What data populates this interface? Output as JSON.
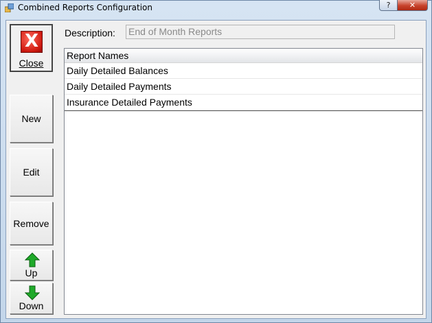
{
  "window": {
    "title": "Combined Reports Configuration",
    "help_glyph": "?",
    "close_glyph": "✕"
  },
  "sidebar": {
    "close_label": "Close",
    "close_glyph": "X",
    "new_label": "New",
    "edit_label": "Edit",
    "remove_label": "Remove",
    "up_label": "Up",
    "down_label": "Down"
  },
  "description": {
    "label": "Description:",
    "value": "End of Month Reports"
  },
  "grid": {
    "header": "Report Names",
    "rows": [
      "Daily Detailed Balances",
      "Daily Detailed Payments",
      "Insurance Detailed Payments"
    ]
  },
  "colors": {
    "close_red": "#cf1a10",
    "arrow_green": "#1faa2a",
    "frame_blue": "#c9d9ea"
  }
}
